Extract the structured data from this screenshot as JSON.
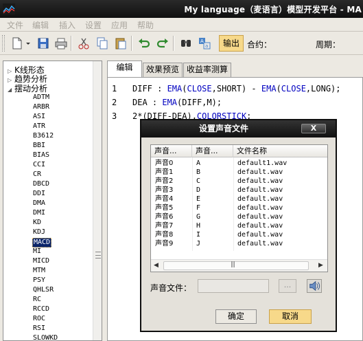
{
  "window": {
    "title": "My language（麦语言）模型开发平台 - MA"
  },
  "menu": [
    "文件",
    "编辑",
    "插入",
    "设置",
    "应用",
    "帮助"
  ],
  "toolbar": {
    "output_label": "输出",
    "contract_label": "合约：",
    "period_label": "周期："
  },
  "tree": {
    "groups": [
      "K线形态",
      "趋势分析",
      "摆动分析"
    ],
    "items": [
      "ADTM",
      "ARBR",
      "ASI",
      "ATR",
      "B3612",
      "BBI",
      "BIAS",
      "CCI",
      "CR",
      "DBCD",
      "DDI",
      "DMA",
      "DMI",
      "KD",
      "KDJ",
      "MACD",
      "MI",
      "MICD",
      "MTM",
      "PSY",
      "QHLSR",
      "RC",
      "RCCD",
      "ROC",
      "RSI",
      "SLOWKD"
    ],
    "selected": "MACD"
  },
  "editor": {
    "tabs": [
      "编辑",
      "效果预览",
      "收益率测算"
    ],
    "active_tab": "编辑",
    "lines": [
      {
        "num": "1",
        "text": "DIFF : EMA(CLOSE,SHORT) - EMA(CLOSE,LONG);"
      },
      {
        "num": "2",
        "text": "DEA  : EMA(DIFF,M);"
      },
      {
        "num": "3",
        "text": "2*(DIFF-DEA),COLORSTICK;"
      }
    ]
  },
  "dialog": {
    "title": "设置声音文件",
    "close_label": "X",
    "columns": [
      "声音...",
      "声音...",
      "文件名称"
    ],
    "rows": [
      {
        "name": "声音0",
        "key": "A",
        "file": "default1.wav"
      },
      {
        "name": "声音1",
        "key": "B",
        "file": "default.wav"
      },
      {
        "name": "声音2",
        "key": "C",
        "file": "default.wav"
      },
      {
        "name": "声音3",
        "key": "D",
        "file": "default.wav"
      },
      {
        "name": "声音4",
        "key": "E",
        "file": "default.wav"
      },
      {
        "name": "声音5",
        "key": "F",
        "file": "default.wav"
      },
      {
        "name": "声音6",
        "key": "G",
        "file": "default.wav"
      },
      {
        "name": "声音7",
        "key": "H",
        "file": "default.wav"
      },
      {
        "name": "声音8",
        "key": "I",
        "file": "default.wav"
      },
      {
        "name": "声音9",
        "key": "J",
        "file": "default.wav"
      }
    ],
    "file_label": "声音文件：",
    "file_value": "",
    "browse_label": "...",
    "ok_label": "确定",
    "cancel_label": "取消"
  },
  "colors": {
    "title_bar": "#111111",
    "highlight_button": "#f7d98a",
    "selection": "#0a246a",
    "keyword": "#0000c0"
  },
  "icons": [
    "app-icon",
    "new-file-icon",
    "dropdown-arrow-icon",
    "save-icon",
    "print-icon",
    "cut-icon",
    "copy-icon",
    "paste-icon",
    "undo-icon",
    "redo-icon",
    "formula-list-icon",
    "find-icon",
    "translate-icon",
    "speaker-icon"
  ]
}
